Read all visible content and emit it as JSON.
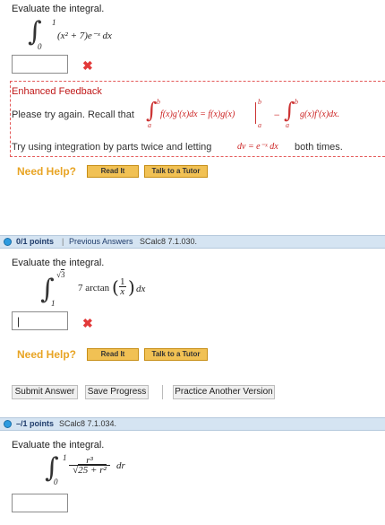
{
  "q1": {
    "prompt": "Evaluate the integral.",
    "int_upper": "1",
    "int_lower": "0",
    "integrand": "(x² + 7)e⁻ˣ dx",
    "answer_value": "",
    "feedback": {
      "title": "Enhanced Feedback",
      "line1_text": "Please try again. Recall that",
      "upper_b": "b",
      "lower_a": "a",
      "formula_left": "f(x)g′(x)dx = f(x)g(x)",
      "minus": "−",
      "formula_right": "g(x)f′(x)dx.",
      "line2": "Try using integration by parts twice and letting",
      "line2_math": "dv = e⁻ˣ dx",
      "line2_end": "both times."
    },
    "need_help": "Need Help?",
    "read_it": "Read It",
    "talk_tutor": "Talk to a Tutor"
  },
  "q2": {
    "points": "0/1 points",
    "sep": "|",
    "prev_answers": "Previous Answers",
    "source": "SCalc8 7.1.030.",
    "prompt": "Evaluate the integral.",
    "int_upper": "√3",
    "int_lower": "1",
    "integrand_coef": "7 arctan",
    "frac_num": "1",
    "frac_den": "x",
    "dx": "dx",
    "answer_value": "|",
    "need_help": "Need Help?",
    "read_it": "Read It",
    "talk_tutor": "Talk to a Tutor",
    "submit": "Submit Answer",
    "save": "Save Progress",
    "practice": "Practice Another Version"
  },
  "q3": {
    "points": "–/1 points",
    "source": "SCalc8 7.1.034.",
    "prompt": "Evaluate the integral.",
    "int_upper": "1",
    "int_lower": "0",
    "num": "r³",
    "den_root": "25 + r²",
    "dr": "dr",
    "answer_value": ""
  },
  "colors": {
    "error_red": "#e23a3a",
    "help_orange": "#e8a424",
    "header_blue": "#d5e4f2",
    "link_blue": "#1f3c6b"
  }
}
